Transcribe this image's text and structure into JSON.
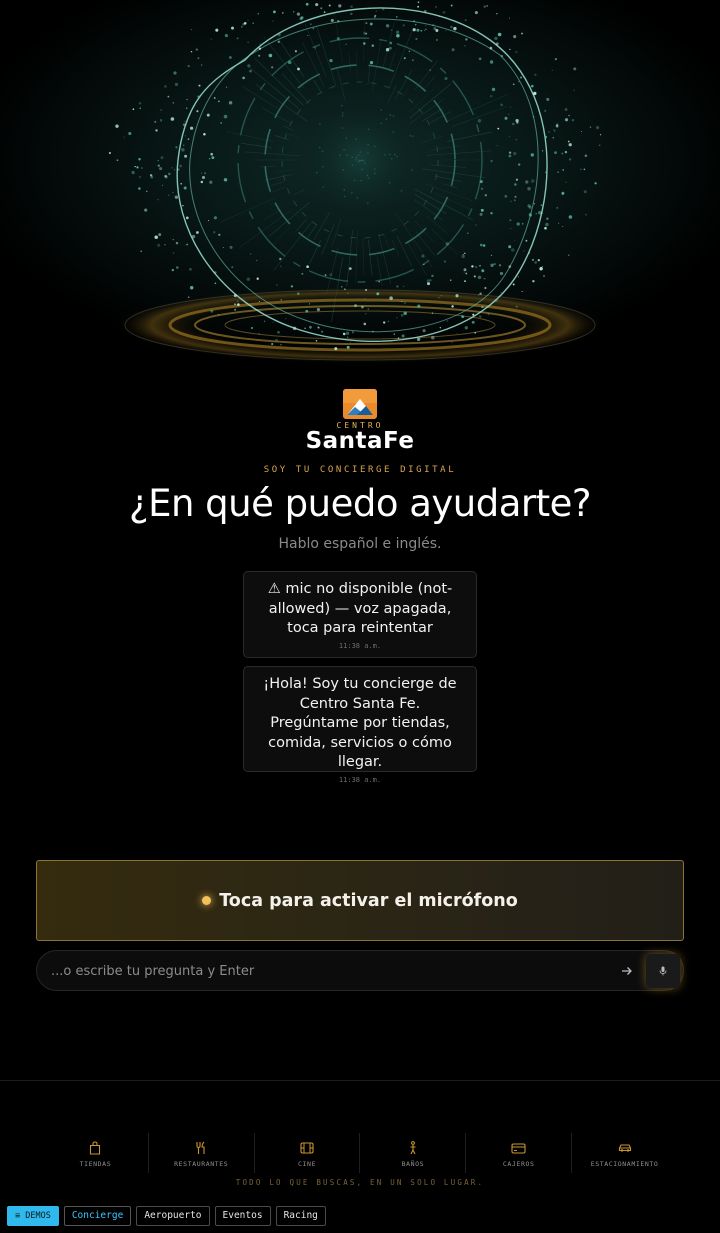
{
  "brand": {
    "prefix": "CENTRO",
    "name": "SantaFe",
    "colors": {
      "accent": "#e7a94d",
      "mic_glow": "#f2c15a",
      "demos": "#2fb9ec"
    }
  },
  "hero": {
    "eyebrow": "SOY TU CONCIERGE DIGITAL",
    "headline": "¿En qué puedo ayudarte?",
    "subline": "Hablo español e inglés."
  },
  "messages": [
    {
      "text": "⚠ mic no disponible (not-allowed) — voz apagada, toca para reintentar",
      "time": "11:38 a.m."
    },
    {
      "text": "¡Hola! Soy tu concierge de Centro Santa Fe. Pregúntame por tiendas, comida, servicios o cómo llegar.",
      "time": "11:38 a.m."
    }
  ],
  "mic_button": {
    "label": "Toca para activar el micrófono"
  },
  "query": {
    "placeholder": "...o escribe tu pregunta y Enter",
    "value": ""
  },
  "nav": {
    "items": [
      {
        "label": "TIENDAS",
        "icon": "shopping-bag-icon"
      },
      {
        "label": "RESTAURANTES",
        "icon": "utensils-icon"
      },
      {
        "label": "CINE",
        "icon": "film-icon"
      },
      {
        "label": "BAÑOS",
        "icon": "restroom-icon"
      },
      {
        "label": "CAJEROS",
        "icon": "credit-card-icon"
      },
      {
        "label": "ESTACIONAMIENTO",
        "icon": "car-icon"
      }
    ],
    "tagline": "TODO LO QUE BUSCAS, EN UN SOLO LUGAR."
  },
  "demos": {
    "toggle_label": "≡ DEMOS",
    "items": [
      "Concierge",
      "Aeropuerto",
      "Eventos",
      "Racing"
    ],
    "active": "Concierge"
  }
}
